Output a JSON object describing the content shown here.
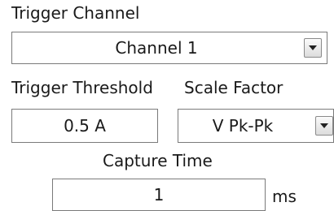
{
  "trigger_channel": {
    "label": "Trigger Channel",
    "value": "Channel 1",
    "dropdown_icon": "chevron-down-icon"
  },
  "trigger_threshold": {
    "label": "Trigger Threshold",
    "value": "0.5 A"
  },
  "scale_factor": {
    "label": "Scale Factor",
    "value": "V Pk-Pk",
    "dropdown_icon": "chevron-down-icon"
  },
  "capture_time": {
    "label": "Capture Time",
    "value": "1",
    "unit": "ms"
  }
}
